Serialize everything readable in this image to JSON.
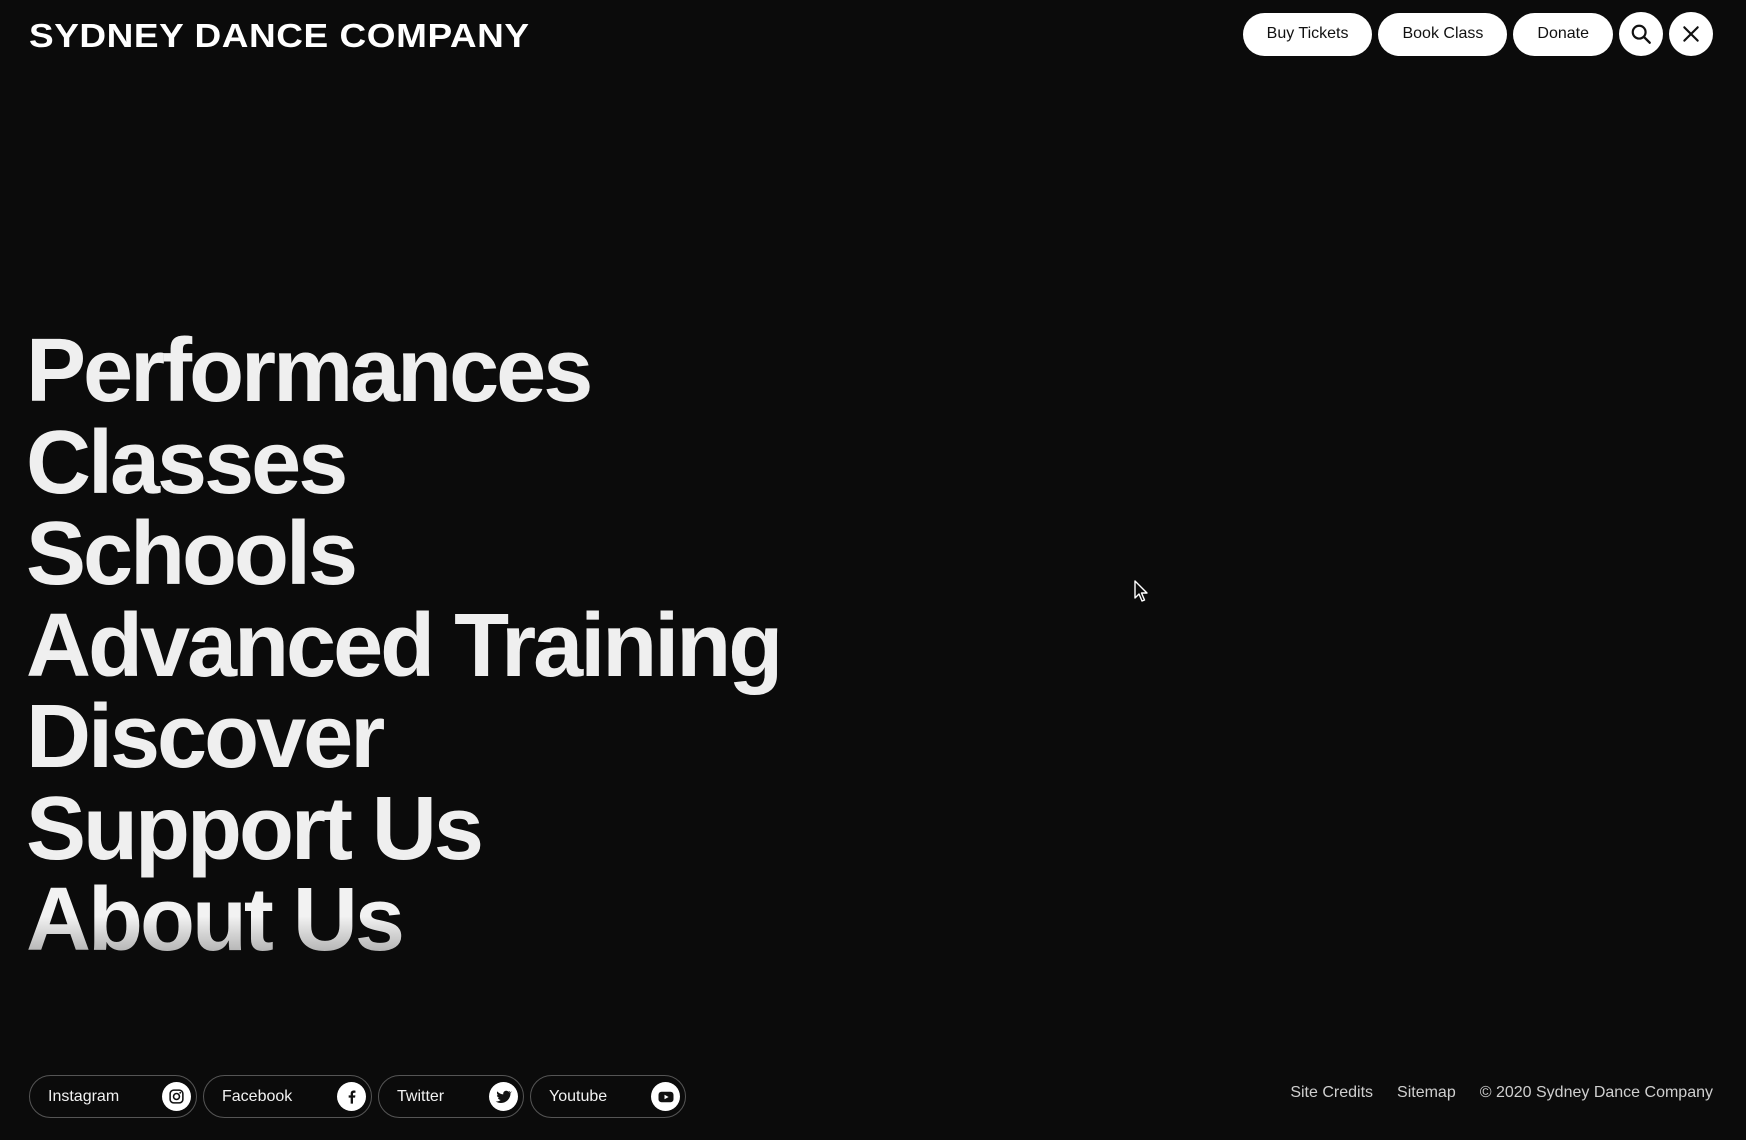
{
  "header": {
    "logo": "SYDNEY DANCE COMPANY",
    "buttons": {
      "buy_tickets": "Buy Tickets",
      "book_class": "Book Class",
      "donate": "Donate"
    },
    "icons": {
      "search": "search-icon",
      "close": "close-icon"
    }
  },
  "menu": {
    "items": [
      {
        "label": "Performances"
      },
      {
        "label": "Classes"
      },
      {
        "label": "Schools"
      },
      {
        "label": "Advanced Training"
      },
      {
        "label": "Discover"
      },
      {
        "label": "Support Us"
      },
      {
        "label": "About Us"
      }
    ]
  },
  "footer": {
    "socials": [
      {
        "label": "Instagram",
        "icon": "instagram-icon"
      },
      {
        "label": "Facebook",
        "icon": "facebook-icon"
      },
      {
        "label": "Twitter",
        "icon": "twitter-icon"
      },
      {
        "label": "Youtube",
        "icon": "youtube-icon"
      }
    ],
    "links": {
      "site_credits": "Site Credits",
      "sitemap": "Sitemap",
      "copyright": "© 2020 Sydney Dance Company"
    }
  },
  "colors": {
    "background": "#0b0b0b",
    "text": "#f2f2f2",
    "button": "#ffffff"
  }
}
